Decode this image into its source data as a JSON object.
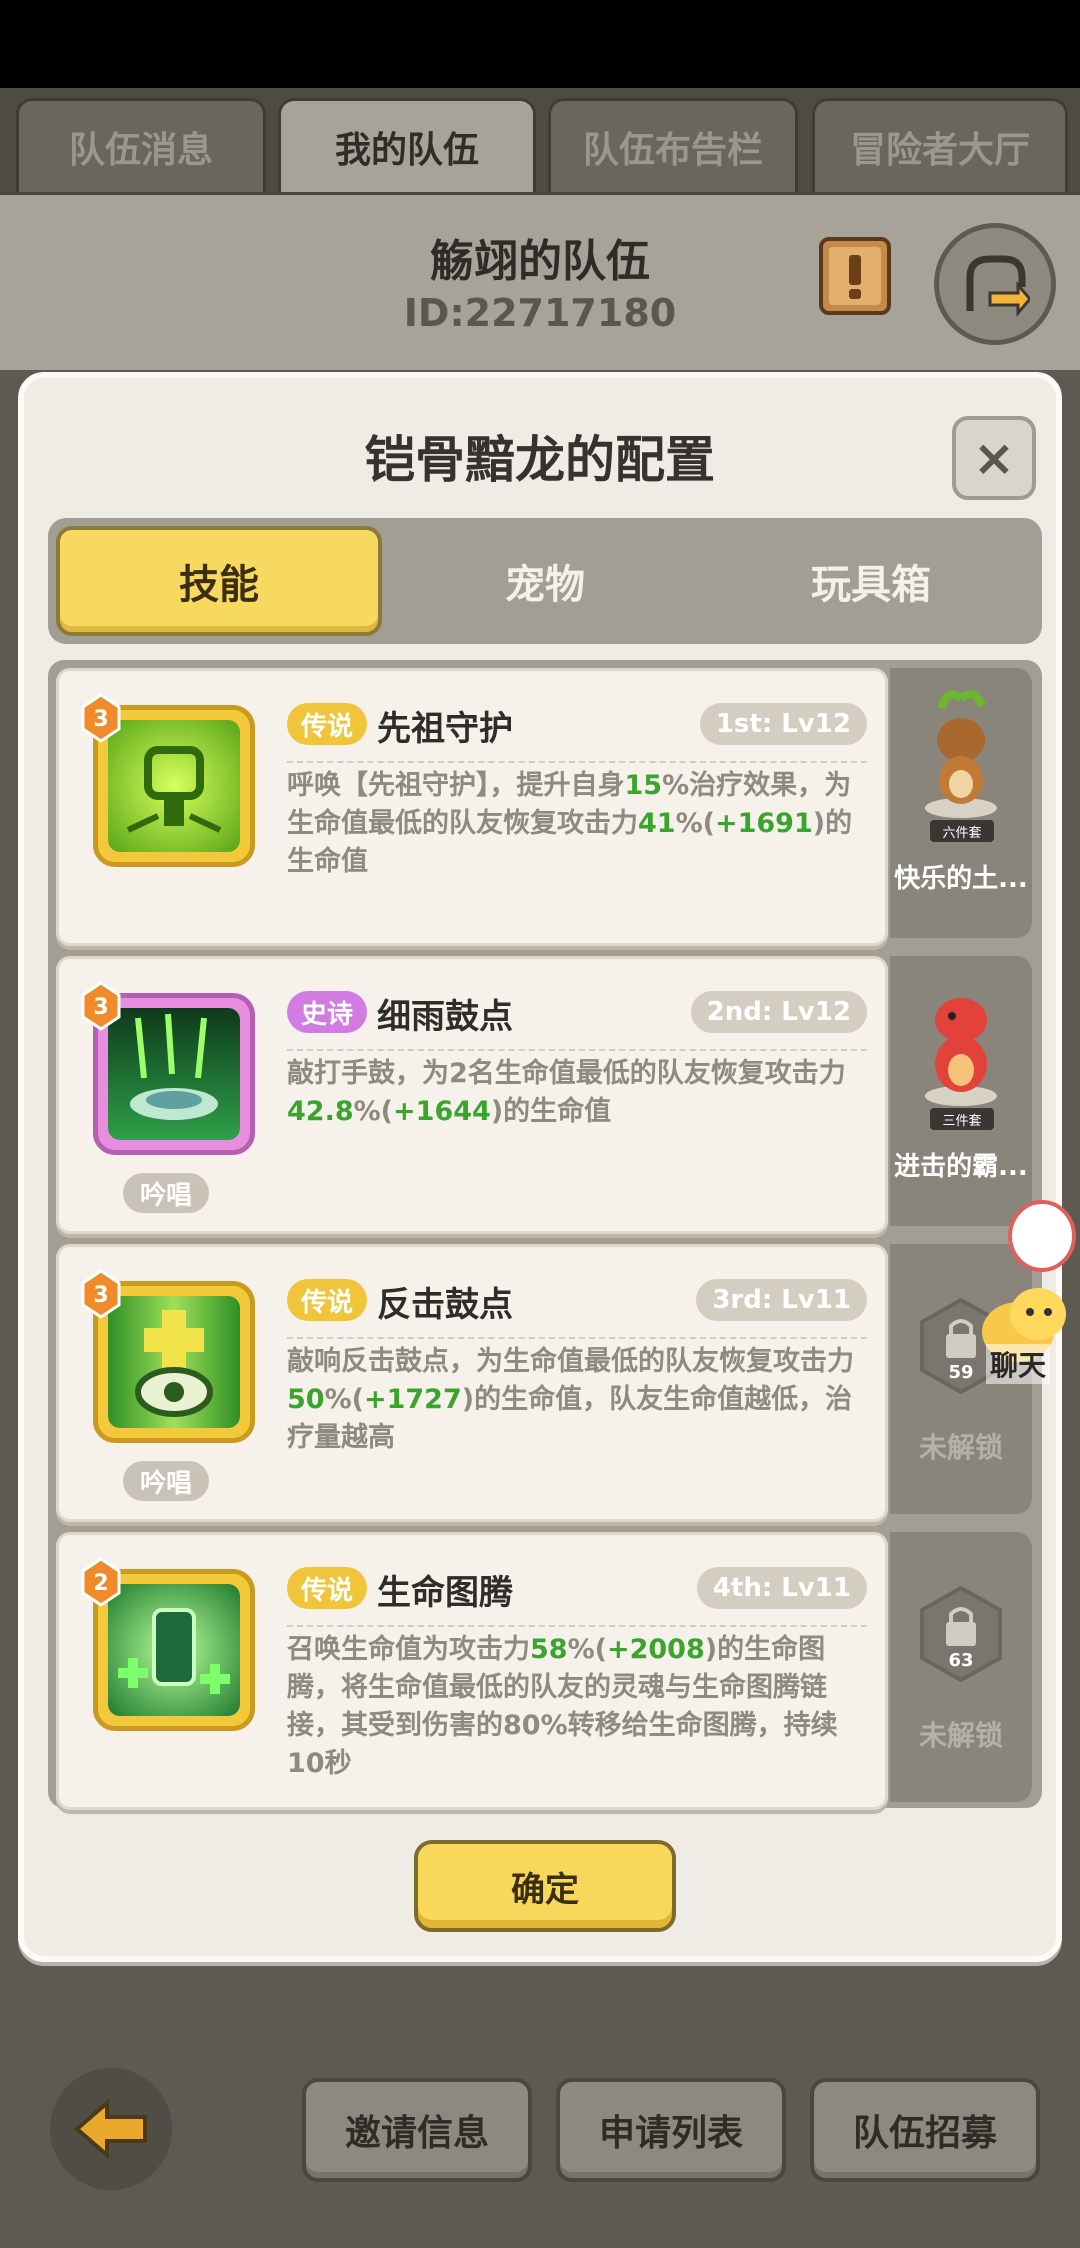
{
  "top_tabs": [
    "队伍消息",
    "我的队伍",
    "队伍布告栏",
    "冒险者大厅"
  ],
  "team": {
    "name": "觞翊的队伍",
    "id": "ID:22717180"
  },
  "modal": {
    "title": "铠骨黯龙的配置",
    "close": "×",
    "segments": [
      "技能",
      "宠物",
      "玩具箱"
    ],
    "confirm": "确定"
  },
  "skills": [
    {
      "level": "3",
      "rarity": "传说",
      "name": "先祖守护",
      "slot": "1st: Lv12",
      "chant": "",
      "desc_parts": [
        "呼唤【先祖守护】，提升自身",
        "15",
        "%治疗效果，为生命值最低的队友恢复攻击力",
        "41",
        "%(",
        "+1691",
        ")的生命值"
      ]
    },
    {
      "level": "3",
      "rarity": "史诗",
      "name": "细雨鼓点",
      "slot": "2nd: Lv12",
      "chant": "吟唱",
      "desc_parts": [
        "敲打手鼓，为2名生命值最低的队友恢复攻击力",
        "42.8",
        "%(",
        "+1644",
        ")的生命值"
      ]
    },
    {
      "level": "3",
      "rarity": "传说",
      "name": "反击鼓点",
      "slot": "3rd: Lv11",
      "chant": "吟唱",
      "desc_parts": [
        "敲响反击鼓点，为生命值最低的队友恢复攻击力",
        "50",
        "%(",
        "+1727",
        ")的生命值，队友生命值越低，治疗量越高"
      ]
    },
    {
      "level": "2",
      "rarity": "传说",
      "name": "生命图腾",
      "slot": "4th: Lv11",
      "chant": "",
      "desc_parts": [
        "召唤生命值为攻击力",
        "58",
        "%(",
        "+2008",
        ")的生命图腾，将生命值最低的队友的灵魂与生命图腾链接，其受到伤害的80%转移给生命图腾，持续10秒"
      ]
    }
  ],
  "side_slots": [
    {
      "set": "六件套",
      "label": "快乐的土..."
    },
    {
      "set": "三件套",
      "label": "进击的霸..."
    },
    {
      "lock_level": "59",
      "label": "未解锁"
    },
    {
      "lock_level": "63",
      "label": "未解锁"
    }
  ],
  "chat": {
    "label": "聊天"
  },
  "bottom_buttons": [
    "邀请信息",
    "申请列表",
    "队伍招募"
  ],
  "colors": {
    "accent_yellow": "#f7d860",
    "legend": "#f0c53a",
    "epic": "#d17ce0",
    "highlight_green": "#3aa42f"
  }
}
